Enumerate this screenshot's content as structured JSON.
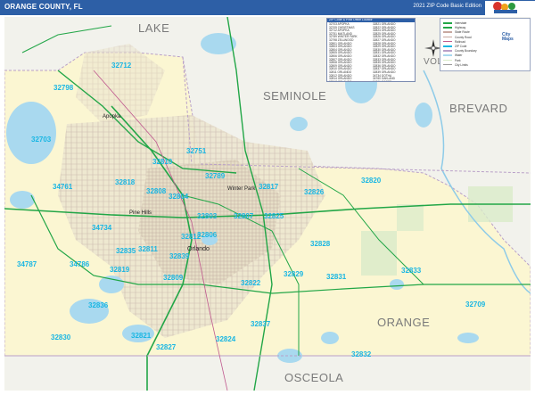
{
  "title": "ORANGE COUNTY, FL",
  "edition": "2021 ZIP Code Basic Edition",
  "logo_text": "Map Sales",
  "colors": {
    "title_bar": "#2d5fa6",
    "land": "#fbf6d2",
    "surrounding": "#f2f2ec",
    "water": "#a9d9ef",
    "zip_label": "#19b6e3",
    "highway": "#22a647",
    "road": "#c8a8a0"
  },
  "regions": [
    "LAKE",
    "SEMINOLE",
    "BREVARD",
    "VOLUSIA",
    "ORANGE",
    "OSCEOLA"
  ],
  "cities": [
    "Apopka",
    "Winter Park",
    "Pine Hills",
    "Orlando"
  ],
  "zip_codes": [
    "32712",
    "32798",
    "32703",
    "32810",
    "32751",
    "32789",
    "32818",
    "32808",
    "32804",
    "32817",
    "32826",
    "32820",
    "34761",
    "32835",
    "32803",
    "32807",
    "32825",
    "34734",
    "32811",
    "32806",
    "32828",
    "34787",
    "34786",
    "32819",
    "32839",
    "32829",
    "32833",
    "32809",
    "32822",
    "32831",
    "32836",
    "32837",
    "32812",
    "32709",
    "32830",
    "32821",
    "32824",
    "32827",
    "32832",
    "32709"
  ],
  "zip_table": {
    "header": "ZIP Code & Post Office Locator",
    "rows": [
      [
        "32703",
        "APOPKA"
      ],
      [
        "32709",
        "CHRISTMAS"
      ],
      [
        "32712",
        "APOPKA"
      ],
      [
        "32751",
        "MAITLAND"
      ],
      [
        "32789",
        "WINTER PARK"
      ],
      [
        "32798",
        "ZELLWOOD"
      ],
      [
        "32801",
        "ORLANDO"
      ],
      [
        "32803",
        "ORLANDO"
      ],
      [
        "32804",
        "ORLANDO"
      ],
      [
        "32805",
        "ORLANDO"
      ],
      [
        "32806",
        "ORLANDO"
      ],
      [
        "32807",
        "ORLANDO"
      ],
      [
        "32808",
        "ORLANDO"
      ],
      [
        "32809",
        "ORLANDO"
      ],
      [
        "32810",
        "ORLANDO"
      ],
      [
        "32811",
        "ORLANDO"
      ],
      [
        "32812",
        "ORLANDO"
      ],
      [
        "32814",
        "ORLANDO"
      ],
      [
        "32817",
        "ORLANDO"
      ],
      [
        "32818",
        "ORLANDO"
      ],
      [
        "32819",
        "ORLANDO"
      ],
      [
        "32820",
        "ORLANDO"
      ],
      [
        "32821",
        "ORLANDO"
      ],
      [
        "32822",
        "ORLANDO"
      ],
      [
        "32824",
        "ORLANDO"
      ],
      [
        "32825",
        "ORLANDO"
      ],
      [
        "32826",
        "ORLANDO"
      ],
      [
        "32827",
        "ORLANDO"
      ],
      [
        "32828",
        "ORLANDO"
      ],
      [
        "32829",
        "ORLANDO"
      ],
      [
        "32830",
        "ORLANDO"
      ],
      [
        "32831",
        "ORLANDO"
      ],
      [
        "32832",
        "ORLANDO"
      ],
      [
        "32833",
        "ORLANDO"
      ],
      [
        "32835",
        "ORLANDO"
      ],
      [
        "32836",
        "ORLANDO"
      ],
      [
        "32837",
        "ORLANDO"
      ],
      [
        "32839",
        "ORLANDO"
      ],
      [
        "34734",
        "GOTHA"
      ],
      [
        "34760",
        "OAKLAND"
      ],
      [
        "34761",
        "OCOEE"
      ],
      [
        "34786",
        "WINDERMERE"
      ],
      [
        "34787",
        "WINTER GARDEN"
      ]
    ]
  },
  "legend": {
    "items": [
      "Interstate",
      "Highway",
      "State Route",
      "County Road",
      "Railroad",
      "ZIP Code",
      "County Boundary",
      "Water",
      "Park",
      "City Limits"
    ]
  }
}
